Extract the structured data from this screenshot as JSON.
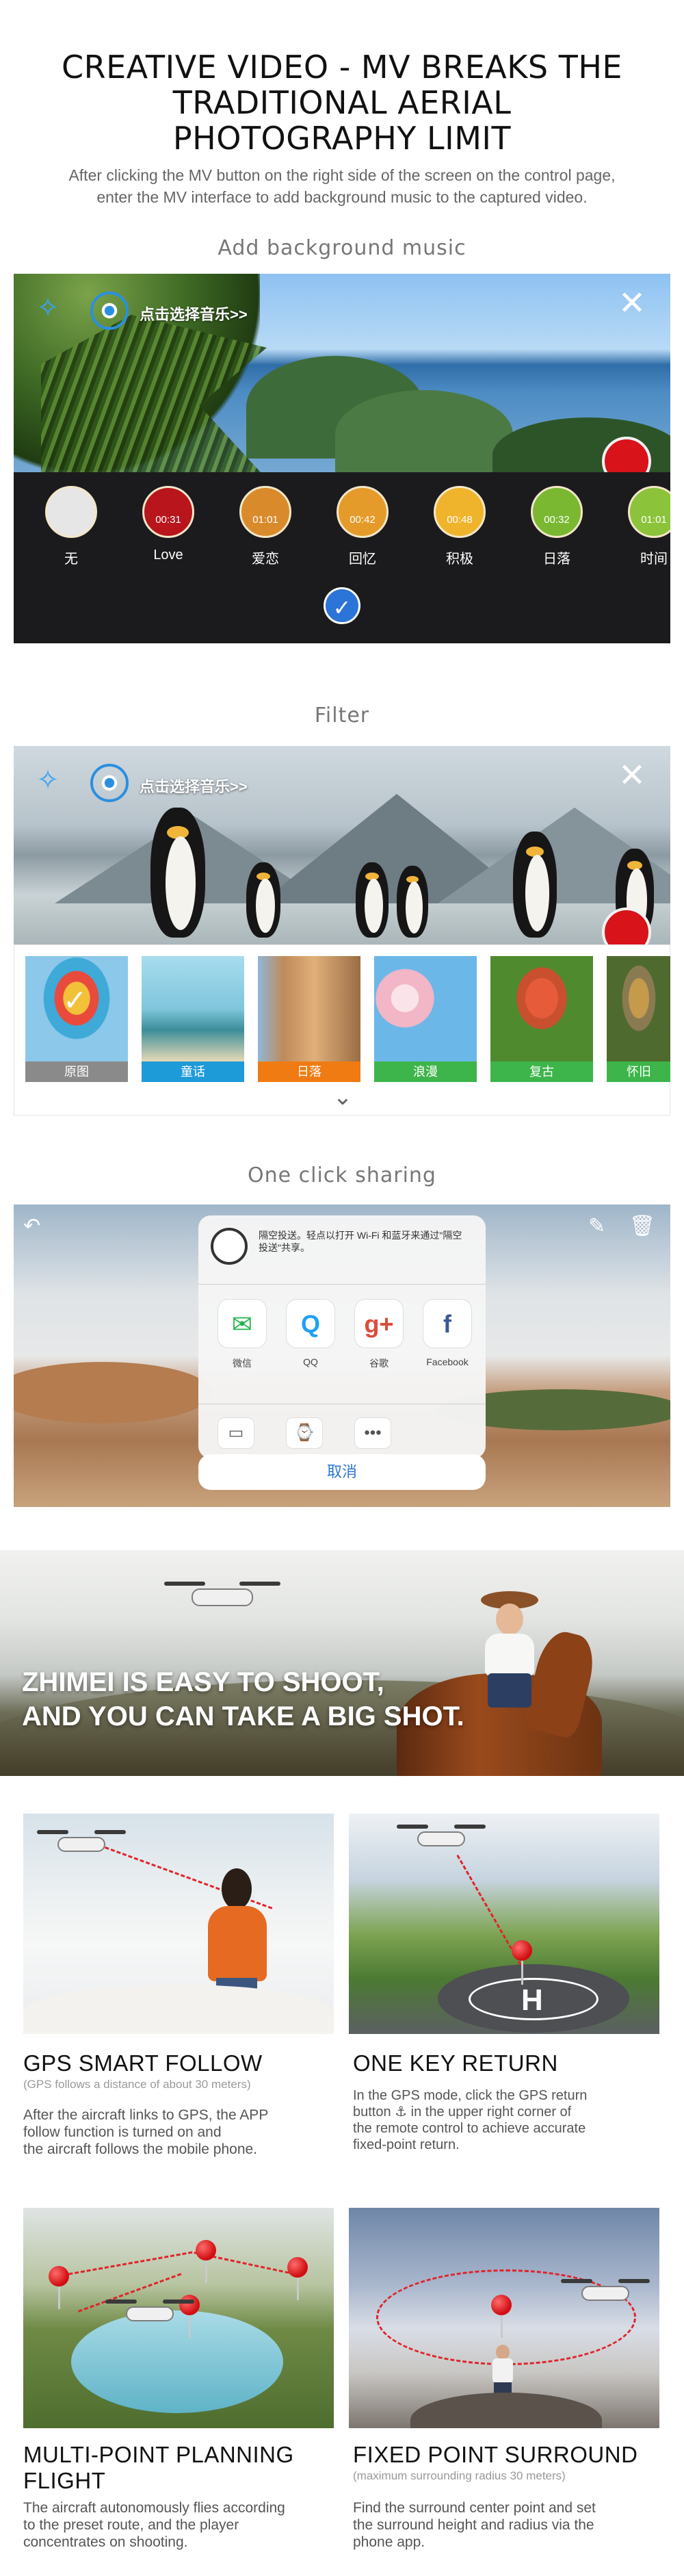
{
  "header": {
    "title_lines": [
      "CREATIVE VIDEO - MV BREAKS THE",
      "TRADITIONAL AERIAL",
      "PHOTOGRAPHY LIMIT"
    ],
    "subtitle_lines": [
      "After clicking the MV button on the right side of the screen on the control page,",
      "enter the MV interface to add background music to the captured video."
    ]
  },
  "music_section": {
    "heading": "Add background music",
    "select_music_text": "点击选择音乐>>",
    "items": [
      {
        "label": "无",
        "time": "",
        "color": "#e6e6e6"
      },
      {
        "label": "Love",
        "time": "00:31",
        "color": "#b8151c"
      },
      {
        "label": "爱恋",
        "time": "01:01",
        "color": "#d98b2c"
      },
      {
        "label": "回忆",
        "time": "00:42",
        "color": "#e59b2a"
      },
      {
        "label": "积极",
        "time": "00:48",
        "color": "#f0b42c"
      },
      {
        "label": "日落",
        "time": "00:32",
        "color": "#7ab832"
      },
      {
        "label": "时间",
        "time": "01:01",
        "color": "#8bc33a"
      }
    ]
  },
  "filter_section": {
    "heading": "Filter",
    "select_music_text": "点击选择音乐>>",
    "filters": [
      {
        "label": "原图",
        "label_color": "#8a8a8a",
        "bg": "#7ec3e8",
        "selected": true
      },
      {
        "label": "童话",
        "label_color": "#1d9ad8",
        "bg": "#7fc6dc",
        "selected": false
      },
      {
        "label": "日落",
        "label_color": "#f07b12",
        "bg": "#c08a5a",
        "selected": false
      },
      {
        "label": "浪漫",
        "label_color": "#3db54a",
        "bg": "#f2b6c6",
        "selected": false
      },
      {
        "label": "复古",
        "label_color": "#3db54a",
        "bg": "#c9502f",
        "selected": false
      },
      {
        "label": "怀旧",
        "label_color": "#3db54a",
        "bg": "#8a7a52",
        "selected": false
      }
    ]
  },
  "share_section": {
    "heading": "One click sharing",
    "airdrop_text": "隔空投送。轻点以打开 Wi-Fi 和蓝牙来通过\"隔空投送\"共享。",
    "apps": [
      {
        "name": "微信",
        "glyph": "✉",
        "color": "#21b34a"
      },
      {
        "name": "QQ",
        "glyph": "Q",
        "color": "#1da1f2"
      },
      {
        "name": "谷歌",
        "glyph": "g+",
        "color": "#dd4b39"
      },
      {
        "name": "Facebook",
        "glyph": "f",
        "color": "#3b5998"
      }
    ],
    "cancel_label": "取消"
  },
  "banner": {
    "text_lines": [
      "ZHIMEI IS EASY TO SHOOT,",
      "AND YOU CAN TAKE A BIG SHOT."
    ]
  },
  "features": [
    {
      "title": "GPS SMART FOLLOW",
      "note": "(GPS follows a distance of about 30 meters)",
      "desc_lines": [
        "After the aircraft links to GPS, the APP",
        "follow function is turned on and",
        "the aircraft follows the mobile phone."
      ]
    },
    {
      "title": "ONE KEY RETURN",
      "note": "",
      "desc_lines": [
        "In the GPS mode, click the GPS return",
        "button ⚓ in the upper right corner of",
        "the remote control to achieve accurate",
        "fixed-point return."
      ]
    },
    {
      "title_lines": [
        "MULTI-POINT PLANNING",
        "FLIGHT"
      ],
      "note": "",
      "desc_lines": [
        "The aircraft autonomously flies according",
        "to the preset route, and the player",
        "concentrates on shooting."
      ]
    },
    {
      "title": "FIXED POINT SURROUND",
      "note": "(maximum surrounding radius 30 meters)",
      "desc_lines": [
        "Find the surround center point and set",
        "the surround height and radius via the",
        "phone app."
      ]
    }
  ]
}
